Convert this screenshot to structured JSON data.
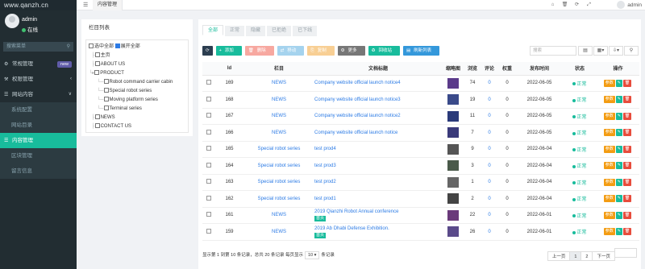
{
  "sidebar": {
    "brand": "www.qanzh.cn",
    "user": "admin",
    "status": "在线",
    "search_placeholder": "搜索菜单",
    "items": [
      {
        "label": "常规管理",
        "badge": "new",
        "type": "top"
      },
      {
        "label": "权限管理",
        "type": "top"
      },
      {
        "label": "网站内容",
        "type": "top"
      },
      {
        "label": "系统配置",
        "type": "sub"
      },
      {
        "label": "网站目录",
        "type": "sub"
      },
      {
        "label": "内容管理",
        "type": "active"
      },
      {
        "label": "区块管理",
        "type": "sub"
      },
      {
        "label": "留言信息",
        "type": "sub"
      }
    ]
  },
  "topbar": {
    "tab": "内容管理",
    "user": "admin"
  },
  "tree": {
    "title": "栏目列表",
    "select_all": "选中全部",
    "expand_all": "展开全部",
    "nodes": [
      {
        "label": "主页",
        "level": 0
      },
      {
        "label": "ABOUT US",
        "level": 0
      },
      {
        "label": "PRODUCT",
        "level": 0
      },
      {
        "label": "Robot command carrier cabin",
        "level": 1
      },
      {
        "label": "Special robot series",
        "level": 1
      },
      {
        "label": "Moving platform series",
        "level": 1
      },
      {
        "label": "Terminal series",
        "level": 1
      },
      {
        "label": "NEWS",
        "level": 0
      },
      {
        "label": "CONTACT US",
        "level": 0
      }
    ]
  },
  "tabs": [
    "全部",
    "正常",
    "隐藏",
    "已拒绝",
    "已下线"
  ],
  "toolbar": {
    "add": "添加",
    "delete": "删除",
    "move": "移动",
    "copy": "复制",
    "more": "更多",
    "recycle": "回收站",
    "refresh": "刷新列表",
    "search_placeholder": "搜索"
  },
  "table": {
    "headers": [
      "Id",
      "栏目",
      "文档标题",
      "缩略图",
      "浏览",
      "评论",
      "权重",
      "发布时间",
      "状态",
      "操作"
    ],
    "status_label": "正常",
    "edit_label": "参数",
    "rows": [
      {
        "id": "169",
        "cat": "NEWS",
        "title": "Company website official launch notice4",
        "views": "74",
        "comments": "0",
        "weight": "0",
        "date": "2022-06-05",
        "thumb": "#5a3a8a"
      },
      {
        "id": "168",
        "cat": "NEWS",
        "title": "Company website official launch notice3",
        "views": "19",
        "comments": "0",
        "weight": "0",
        "date": "2022-06-05",
        "thumb": "#3a4a8a"
      },
      {
        "id": "167",
        "cat": "NEWS",
        "title": "Company website official launch notice2",
        "views": "11",
        "comments": "0",
        "weight": "0",
        "date": "2022-06-05",
        "thumb": "#2a3a7a"
      },
      {
        "id": "166",
        "cat": "NEWS",
        "title": "Company website official launch notice",
        "views": "7",
        "comments": "0",
        "weight": "0",
        "date": "2022-06-05",
        "thumb": "#3a3a7a"
      },
      {
        "id": "165",
        "cat": "Special robot series",
        "title": "test prod4",
        "views": "9",
        "comments": "0",
        "weight": "0",
        "date": "2022-06-04",
        "thumb": "#555"
      },
      {
        "id": "164",
        "cat": "Special robot series",
        "title": "test prod3",
        "views": "3",
        "comments": "0",
        "weight": "0",
        "date": "2022-06-04",
        "thumb": "#4a5a4a"
      },
      {
        "id": "163",
        "cat": "Special robot series",
        "title": "test prod2",
        "views": "1",
        "comments": "0",
        "weight": "0",
        "date": "2022-06-04",
        "thumb": "#666"
      },
      {
        "id": "162",
        "cat": "Special robot series",
        "title": "test prod1",
        "views": "2",
        "comments": "0",
        "weight": "0",
        "date": "2022-06-04",
        "thumb": "#444"
      },
      {
        "id": "161",
        "cat": "NEWS",
        "title": "2019 Qianzhi Robot Annual conference",
        "tag": "首页",
        "views": "22",
        "comments": "0",
        "weight": "0",
        "date": "2022-06-01",
        "thumb": "#6a3a7a"
      },
      {
        "id": "159",
        "cat": "NEWS",
        "title": "2019 Ab Dhabi Defense Exhibition.",
        "tag": "首页",
        "views": "26",
        "comments": "0",
        "weight": "0",
        "date": "2022-06-01",
        "thumb": "#5a4a8a"
      }
    ]
  },
  "footer": {
    "prefix": "显示第 1 到第 10 条记录，总共 20 条记录 每页显示",
    "page_size": "10",
    "suffix": "条记录"
  },
  "pager": {
    "prev": "上一页",
    "pages": [
      "1",
      "2"
    ],
    "next": "下一页"
  }
}
